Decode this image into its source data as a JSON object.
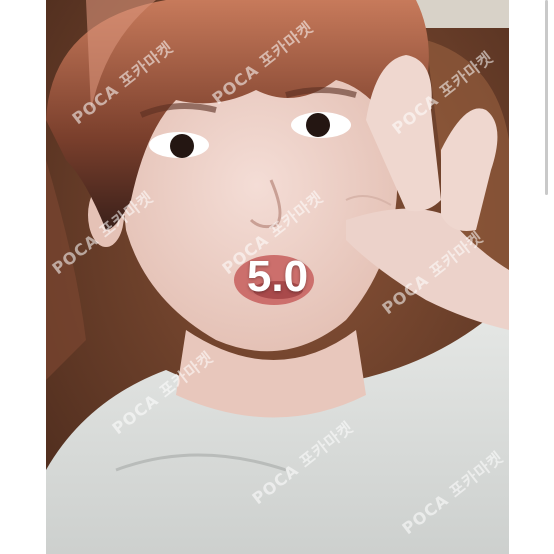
{
  "listing": {
    "price_overlay": "5.0",
    "watermark": "POCA 포카마켓"
  },
  "colors": {
    "overlay_text": "#ffffff",
    "background": "#ffffff"
  }
}
